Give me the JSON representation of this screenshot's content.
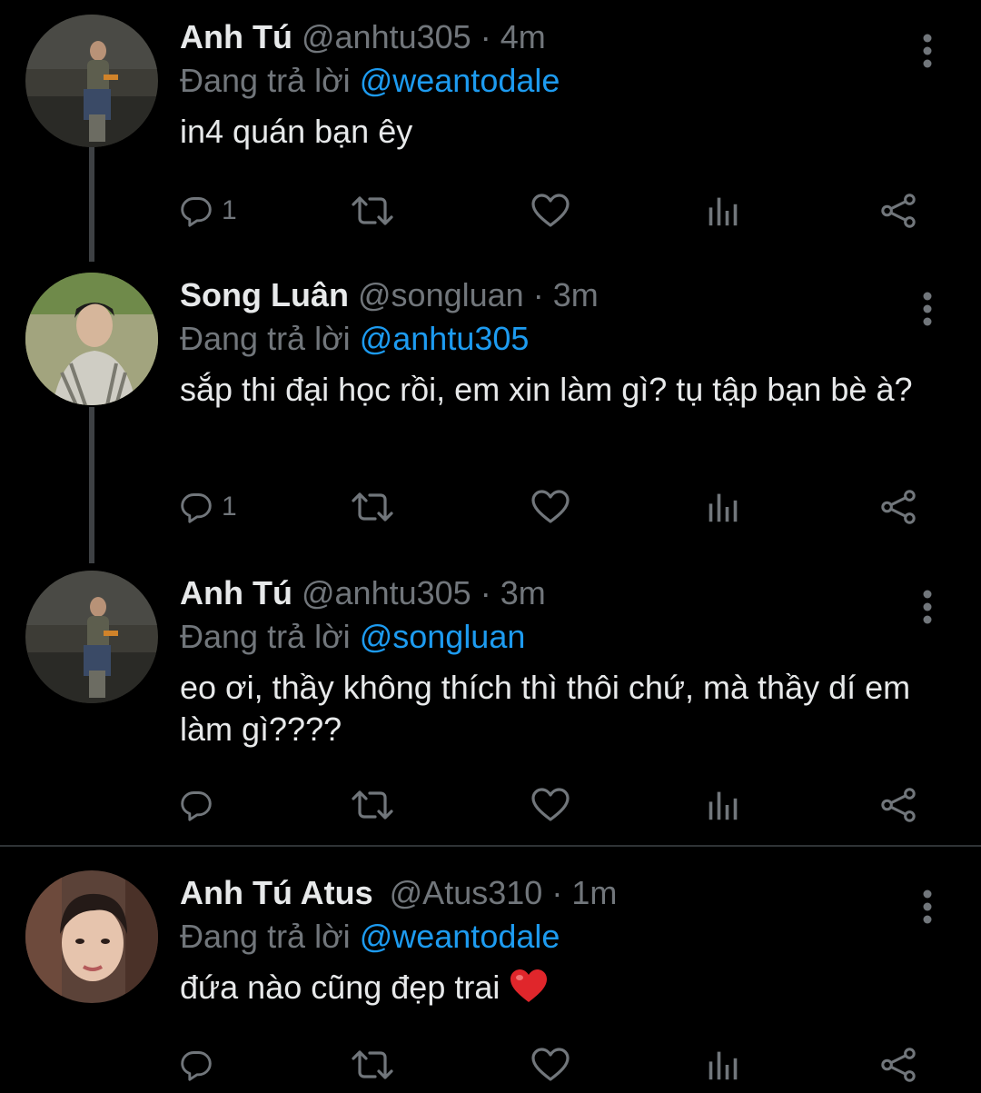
{
  "colors": {
    "background": "#000000",
    "text": "#e7e9ea",
    "secondary": "#71767b",
    "link": "#1d9bf0",
    "heart_emoji": "#e0262b"
  },
  "reply_prefix": "Đang trả lời",
  "tweets": [
    {
      "name": "Anh Tú",
      "handle": "@anhtu305",
      "separator": "·",
      "time": "4m",
      "reply_to": "@weantodale",
      "text": "in4 quán bạn êy",
      "reply_count": "1",
      "avatar_icon": "avatar-photo"
    },
    {
      "name": "Song Luân",
      "handle": "@songluan",
      "separator": "·",
      "time": "3m",
      "reply_to": "@anhtu305",
      "text": "sắp thi đại học rồi, em xin làm gì? tụ tập bạn bè à?",
      "reply_count": "1",
      "avatar_icon": "avatar-photo"
    },
    {
      "name": "Anh Tú",
      "handle": "@anhtu305",
      "separator": "·",
      "time": "3m",
      "reply_to": "@songluan",
      "text": "eo ơi, thầy không thích thì thôi chứ, mà thầy dí em làm gì????",
      "reply_count": "",
      "avatar_icon": "avatar-photo"
    },
    {
      "name": "Anh Tú Atus",
      "handle": "@Atus310",
      "separator": "·",
      "time": "1m",
      "reply_to": "@weantodale",
      "text": "đứa nào cũng đẹp trai",
      "reply_count": "",
      "avatar_icon": "avatar-photo",
      "trailing_emoji": "red-heart-emoji"
    }
  ]
}
